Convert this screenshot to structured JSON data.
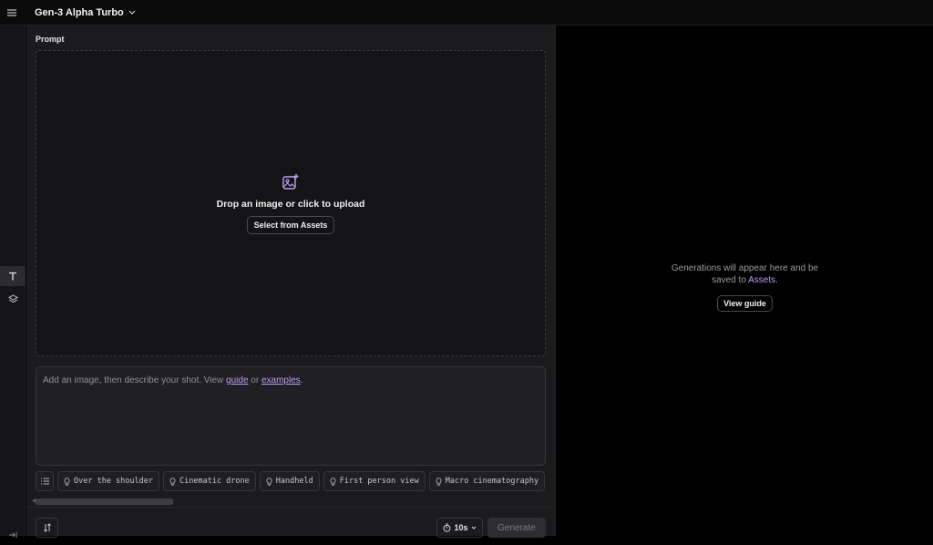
{
  "header": {
    "model_name": "Gen-3 Alpha Turbo"
  },
  "panel": {
    "prompt_label": "Prompt",
    "dropzone": {
      "text": "Drop an image or click to upload",
      "assets_button": "Select from Assets"
    },
    "prompt_input": {
      "placeholder_start": "Add an image, then describe your shot. View ",
      "guide_link": "guide",
      "or_text": " or ",
      "examples_link": "examples",
      "end_text": "."
    },
    "chips": [
      {
        "label": "Over the shoulder"
      },
      {
        "label": "Cinematic drone"
      },
      {
        "label": "Handheld"
      },
      {
        "label": "First person view"
      },
      {
        "label": "Macro cinematography"
      }
    ],
    "duration": "10s",
    "generate_label": "Generate"
  },
  "output": {
    "text_start": "Generations will appear here and be saved to ",
    "assets_link": "Assets",
    "text_end": ".",
    "guide_button": "View guide"
  },
  "colors": {
    "accent": "#c29cf5",
    "panel_bg": "#1b1b1e",
    "app_bg": "#000000"
  }
}
